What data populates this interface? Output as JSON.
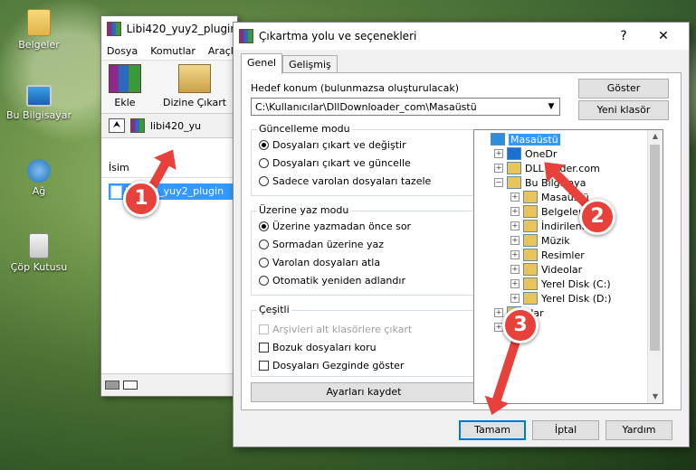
{
  "desktop": {
    "icons": [
      {
        "label": "Belgeler",
        "name": "desktop-icon-belgeler"
      },
      {
        "label": "Bu Bilgisayar",
        "name": "desktop-icon-bu-bilgisayar"
      },
      {
        "label": "Ağ",
        "name": "desktop-icon-ag"
      },
      {
        "label": "Çöp Kutusu",
        "name": "desktop-icon-cop-kutusu"
      }
    ]
  },
  "archive_window": {
    "title": "Libi420_yuy2_plugin",
    "menu": [
      "Dosya",
      "Komutlar",
      "Araçla"
    ],
    "toolbar": {
      "add": "Ekle",
      "extract": "Dizine Çıkart"
    },
    "address": "libi420_yu",
    "column_name": "İsim",
    "file": "libi420_yuy2_plugin"
  },
  "dialog": {
    "title": "Çıkartma yolu ve seçenekleri",
    "help": "?",
    "close": "✕",
    "tabs": [
      "Genel",
      "Gelişmiş"
    ],
    "destination_label": "Hedef konum (bulunmazsa oluşturulacak)",
    "destination_value": "C:\\Kullanıcılar\\DllDownloader_com\\Masaüstü",
    "show_button": "Göster",
    "new_folder_button": "Yeni klasör",
    "update_mode": {
      "title": "Güncelleme modu",
      "options": [
        "Dosyaları çıkart ve değiştir",
        "Dosyaları çıkart ve güncelle",
        "Sadece varolan dosyaları tazele"
      ],
      "selected": 0
    },
    "overwrite_mode": {
      "title": "Üzerine yaz modu",
      "options": [
        "Üzerine yazmadan önce sor",
        "Sormadan üzerine yaz",
        "Varolan dosyaları atla",
        "Otomatik yeniden adlandır"
      ],
      "selected": 0
    },
    "misc": {
      "title": "Çeşitli",
      "options": [
        {
          "label": "Arşivleri alt klasörlere çıkart",
          "disabled": true
        },
        {
          "label": "Bozuk dosyaları koru",
          "disabled": false
        },
        {
          "label": "Dosyaları Gezginde göster",
          "disabled": false
        }
      ]
    },
    "save_settings": "Ayarları kaydet",
    "tree": [
      {
        "label": "Masaüstü",
        "level": 0,
        "exp": "",
        "selected": true
      },
      {
        "label": "OneDr",
        "level": 1,
        "exp": "+"
      },
      {
        "label": "DLL Do",
        "level": 1,
        "exp": "+"
      },
      {
        "label": "loader.com",
        "level": 1,
        "exp": "",
        "offset": true
      },
      {
        "label": "Bu Bilgisaya",
        "level": 1,
        "exp": "−"
      },
      {
        "label": "Masaüstü",
        "level": 2,
        "exp": "+"
      },
      {
        "label": "Belgeler",
        "level": 2,
        "exp": "+"
      },
      {
        "label": "İndirilenler",
        "level": 2,
        "exp": "+"
      },
      {
        "label": "Müzik",
        "level": 2,
        "exp": "+"
      },
      {
        "label": "Resimler",
        "level": 2,
        "exp": "+"
      },
      {
        "label": "Videolar",
        "level": 2,
        "exp": "+"
      },
      {
        "label": "Yerel Disk (C:)",
        "level": 2,
        "exp": "+"
      },
      {
        "label": "Yerel Disk (D:)",
        "level": 2,
        "exp": "+"
      },
      {
        "label": "klar",
        "level": 1,
        "exp": "+"
      },
      {
        "label": "",
        "level": 1,
        "exp": "+"
      }
    ],
    "ok": "Tamam",
    "cancel": "İptal",
    "helpbtn": "Yardım"
  },
  "annotations": [
    "1",
    "2",
    "3"
  ],
  "colors": {
    "accent": "#0078d7",
    "annotation": "#e8403a",
    "selection": "#3399ff"
  }
}
